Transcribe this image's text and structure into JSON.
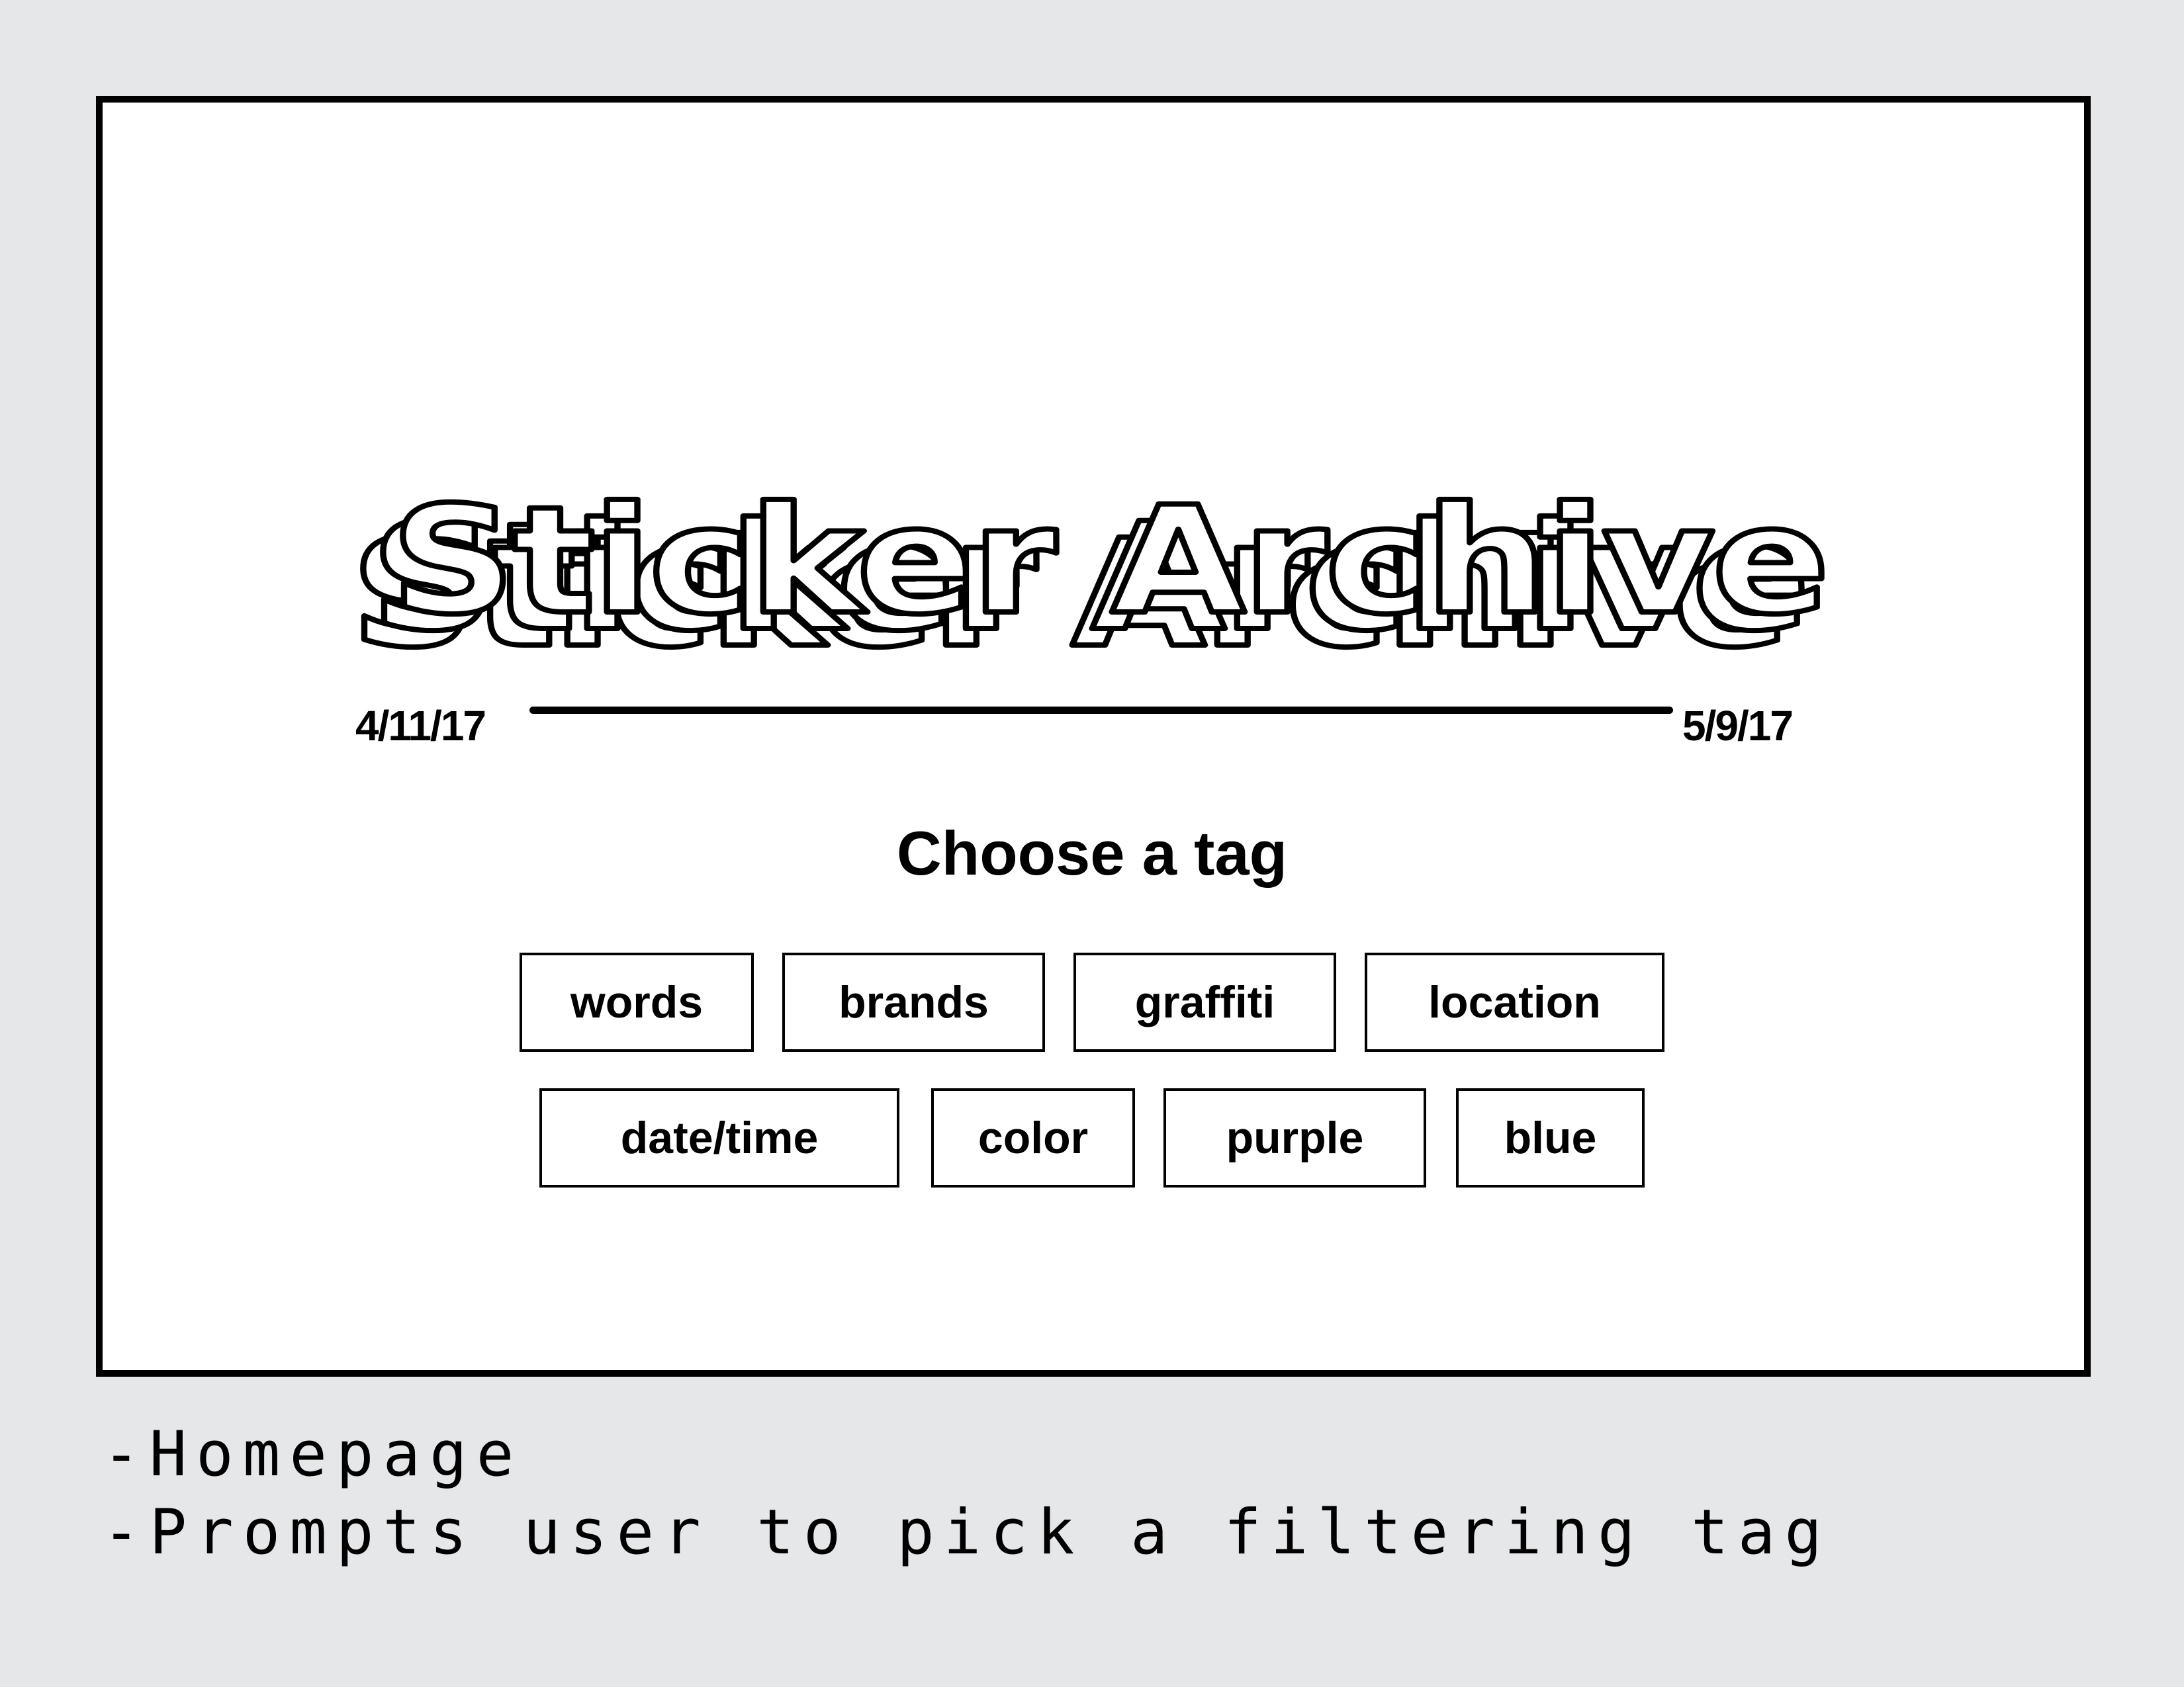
{
  "app": {
    "logo_text": "Sticker Archive"
  },
  "timeline": {
    "start_date": "4/11/17",
    "end_date": "5/9/17"
  },
  "prompt": {
    "heading": "Choose a tag"
  },
  "tags": {
    "row1": [
      "words",
      "brands",
      "graffiti",
      "location"
    ],
    "row2": [
      "date/time",
      "color",
      "purple",
      "blue"
    ]
  },
  "caption": {
    "line1": "-Homepage",
    "line2": "-Prompts user to pick a filtering tag"
  },
  "colors": {
    "page_background": "#e6e7e8",
    "frame_background": "#ffffff",
    "ink": "#000000"
  }
}
